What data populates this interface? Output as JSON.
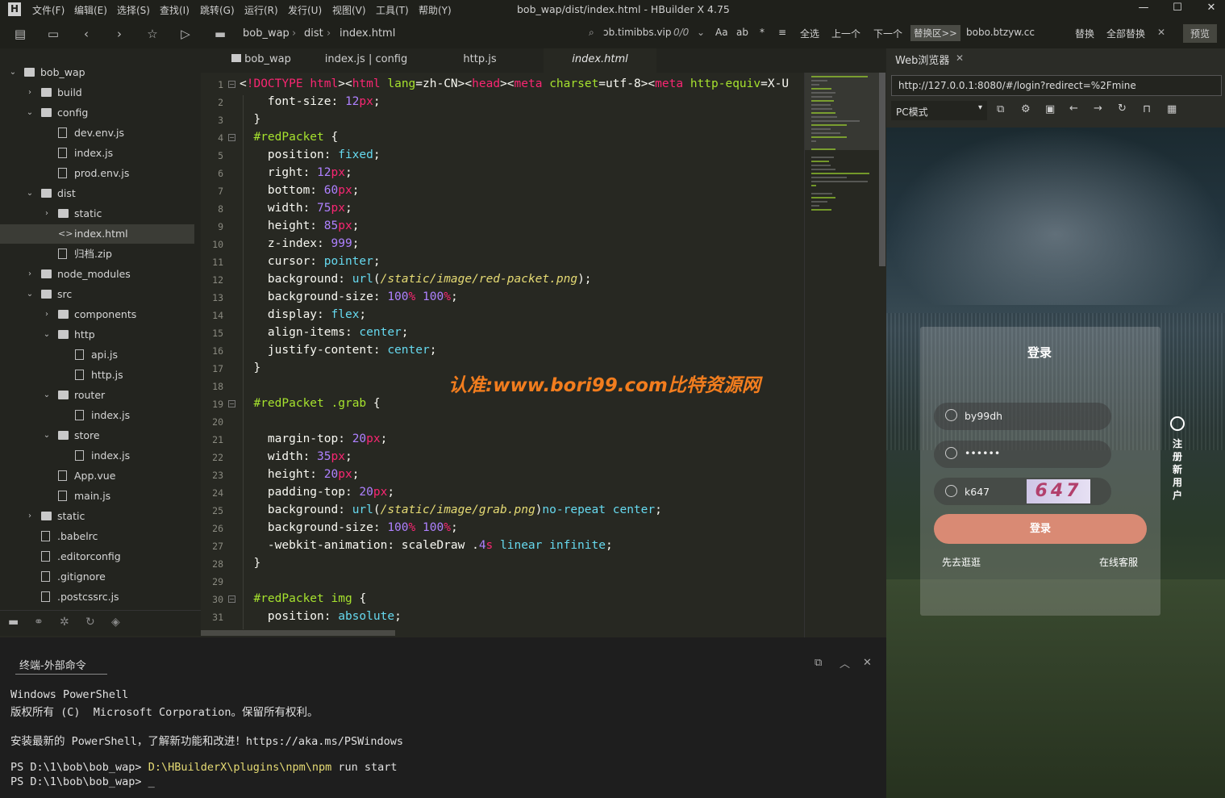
{
  "app": {
    "logo": "H",
    "menu": [
      "文件(F)",
      "编辑(E)",
      "选择(S)",
      "查找(I)",
      "跳转(G)",
      "运行(R)",
      "发行(U)",
      "视图(V)",
      "工具(T)",
      "帮助(Y)"
    ],
    "window_title": "bob_wap/dist/index.html - HBuilder X 4.75"
  },
  "toolbar": {
    "breadcrumb": [
      "bob_wap",
      "dist",
      "index.html"
    ],
    "find_text": "ɔb.timibbs.vip",
    "find_count": "0/0",
    "find_options": [
      "Aa",
      "ab",
      "*",
      "≡"
    ],
    "select_all": "全选",
    "prev": "上一个",
    "next": "下一个",
    "replace_area": "替换区>>",
    "replace_text": "bobo.btzyw.cc",
    "replace": "替换",
    "replace_all": "全部替换",
    "preview": "预览"
  },
  "sidebar": {
    "items": [
      {
        "label": "bob_wap",
        "type": "folder",
        "arrow": "v"
      },
      {
        "label": "build",
        "type": "folder",
        "arrow": ">"
      },
      {
        "label": "config",
        "type": "folder",
        "arrow": "v"
      },
      {
        "label": "dev.env.js",
        "type": "file",
        "arrow": ""
      },
      {
        "label": "index.js",
        "type": "file",
        "arrow": ""
      },
      {
        "label": "prod.env.js",
        "type": "file",
        "arrow": ""
      },
      {
        "label": "dist",
        "type": "folder",
        "arrow": "v"
      },
      {
        "label": "static",
        "type": "folder",
        "arrow": ">"
      },
      {
        "label": "index.html",
        "type": "html",
        "arrow": ""
      },
      {
        "label": "归档.zip",
        "type": "file",
        "arrow": ""
      },
      {
        "label": "node_modules",
        "type": "folder",
        "arrow": ">"
      },
      {
        "label": "src",
        "type": "folder",
        "arrow": "v"
      },
      {
        "label": "components",
        "type": "folder",
        "arrow": ">"
      },
      {
        "label": "http",
        "type": "folder",
        "arrow": "v"
      },
      {
        "label": "api.js",
        "type": "file",
        "arrow": ""
      },
      {
        "label": "http.js",
        "type": "file",
        "arrow": ""
      },
      {
        "label": "router",
        "type": "folder",
        "arrow": "v"
      },
      {
        "label": "index.js",
        "type": "file",
        "arrow": ""
      },
      {
        "label": "store",
        "type": "folder",
        "arrow": "v"
      },
      {
        "label": "index.js",
        "type": "file",
        "arrow": ""
      },
      {
        "label": "App.vue",
        "type": "file",
        "arrow": ""
      },
      {
        "label": "main.js",
        "type": "file",
        "arrow": ""
      },
      {
        "label": "static",
        "type": "folder",
        "arrow": ">"
      },
      {
        "label": ".babelrc",
        "type": "file",
        "arrow": ""
      },
      {
        "label": ".editorconfig",
        "type": "file",
        "arrow": ""
      },
      {
        "label": ".gitignore",
        "type": "file",
        "arrow": ""
      },
      {
        "label": ".postcssrc.js",
        "type": "file",
        "arrow": ""
      }
    ]
  },
  "tabs": [
    "bob_wap",
    "index.js | config",
    "http.js",
    "index.html"
  ],
  "editor": {
    "lines": [
      "<!DOCTYPE html><html lang=zh-CN><head><meta charset=utf-8><meta http-equiv=X-U",
      "    font-size: 12px;",
      "  }",
      "  #redPacket {",
      "    position: fixed;",
      "    right: 12px;",
      "    bottom: 60px;",
      "    width: 75px;",
      "    height: 85px;",
      "    z-index: 999;",
      "    cursor: pointer;",
      "    background: url(/static/image/red-packet.png);",
      "    background-size: 100% 100%;",
      "    display: flex;",
      "    align-items: center;",
      "    justify-content: center;",
      "  }",
      "",
      "  #redPacket .grab {",
      "",
      "    margin-top: 20px;",
      "    width: 35px;",
      "    height: 20px;",
      "    padding-top: 20px;",
      "    background: url(/static/image/grab.png)no-repeat center;",
      "    background-size: 100% 100%;",
      "    -webkit-animation: scaleDraw .4s linear infinite;",
      "  }",
      "",
      "  #redPacket img {",
      "    position: absolute;"
    ],
    "watermark": "认准:www.bori99.com比特资源网"
  },
  "terminal": {
    "tab": "终端-外部命令",
    "lines": [
      "Windows PowerShell",
      "版权所有 (C)  Microsoft Corporation。保留所有权利。",
      "",
      "安装最新的 PowerShell，了解新功能和改进！https://aka.ms/PSWindows",
      "",
      "PS D:\\1\\bob\\bob_wap> ",
      "PS D:\\1\\bob\\bob_wap> _"
    ],
    "command_path": "D:\\HBuilderX\\plugins\\npm\\npm",
    "command_args": " run start"
  },
  "browser": {
    "tab": "Web浏览器",
    "url": "http://127.0.0.1:8080/#/login?redirect=%2Fmine",
    "mode": "PC模式",
    "login": {
      "title": "登录",
      "username": "by99dh",
      "password": "••••••",
      "captcha_input": "k647",
      "captcha_image": "647",
      "button": "登录",
      "browse": "先去逛逛",
      "service": "在线客服",
      "register": "注册新用户",
      "button_color": "#d98a74"
    }
  }
}
